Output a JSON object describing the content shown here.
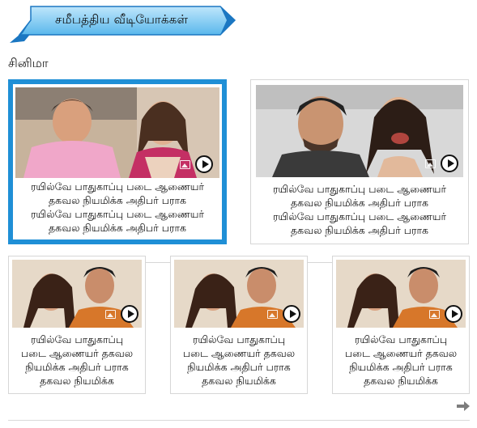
{
  "header": {
    "title": "சமீபத்திய வீடியோக்கள்",
    "banner_color": "#5ab8ec",
    "banner_dark": "#1b77c2"
  },
  "section": {
    "label": "சினிமா"
  },
  "featured": [
    {
      "caption": [
        "ரயில்வே பாதுகாப்பு படை ஆணையர்",
        "தகவல நியமிக்க  அதிபர் பராக",
        "ரயில்வே பாதுகாப்பு படை ஆணையர்",
        "தகவல நியமிக்க  அதிபர் பராக"
      ],
      "image": "couple-photo-1",
      "active": true
    },
    {
      "caption": [
        "ரயில்வே பாதுகாப்பு படை ஆணையர்",
        "தகவல நியமிக்க  அதிபர் பராக",
        "ரயில்வே பாதுகாப்பு படை ஆணையர்",
        "தகவல நியமிக்க  அதிபர் பராக"
      ],
      "image": "couple-photo-2",
      "active": false
    }
  ],
  "small": [
    {
      "caption": [
        "ரயில்வே பாதுகாப்பு",
        "படை ஆணையர் தகவல",
        "நியமிக்க  அதிபர் பராக",
        "தகவல நியமிக்க"
      ],
      "image": "couple-photo-3"
    },
    {
      "caption": [
        "ரயில்வே பாதுகாப்பு",
        "படை ஆணையர் தகவல",
        "நியமிக்க  அதிபர் பராக",
        "தகவல நியமிக்க"
      ],
      "image": "couple-photo-3"
    },
    {
      "caption": [
        "ரயில்வே பாதுகாப்பு",
        "படை ஆணையர் தகவல",
        "நியமிக்க  அதிபர் பராக",
        "தகவல நியமிக்க"
      ],
      "image": "couple-photo-3"
    }
  ],
  "icons": {
    "gallery": "image-icon",
    "play": "play-icon",
    "next": "next-arrow-icon"
  },
  "colors": {
    "active_border": "#1f8fd6",
    "card_border": "#d6d6d6"
  }
}
